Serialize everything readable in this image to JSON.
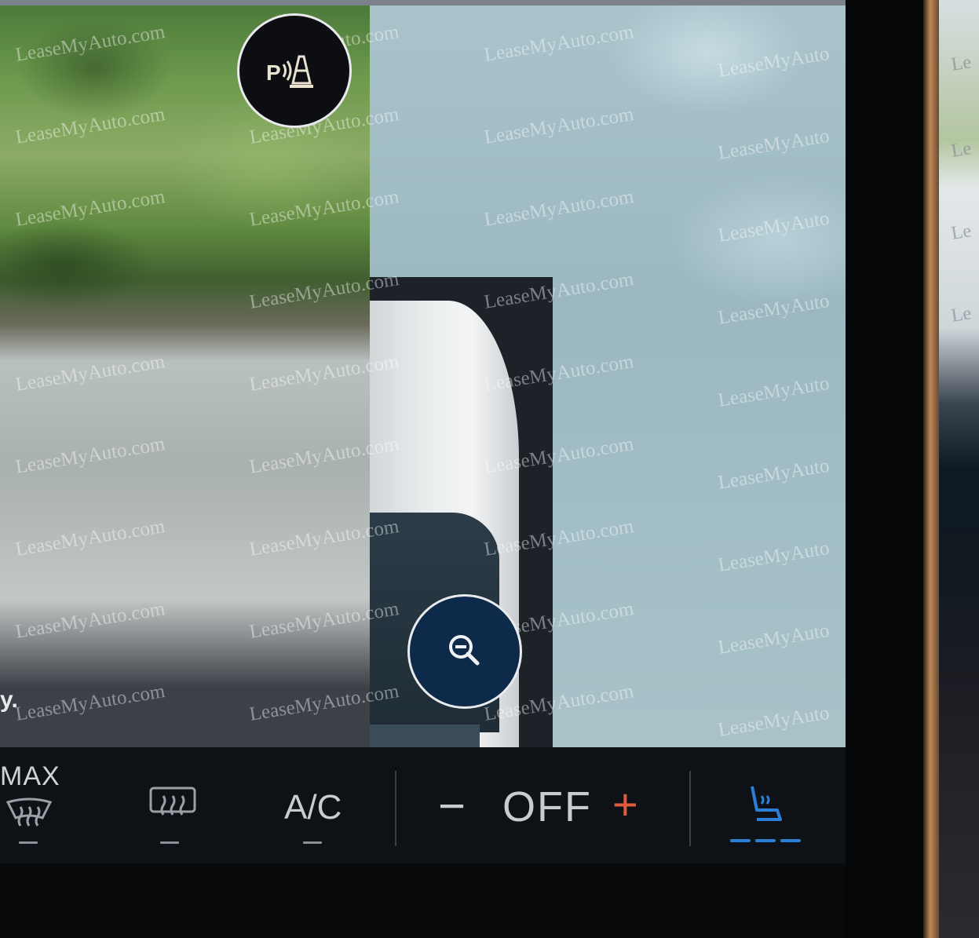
{
  "camera": {
    "caption_fragment": "y.",
    "watermark": "LeaseMyAuto.com",
    "watermark_cut": "LeaseMyAuto",
    "watermark_edge": "Le"
  },
  "buttons": {
    "parking_sensor_icon": "parking-sensor-icon",
    "zoom_out_icon": "zoom-out-icon"
  },
  "climate": {
    "max_defrost_label": "MAX",
    "ac_label": "A/C",
    "fan_status": "OFF",
    "minus_label": "−",
    "plus_label": "+",
    "colors": {
      "plus": "#e05a3c",
      "seat_active": "#2b7fd6"
    }
  }
}
